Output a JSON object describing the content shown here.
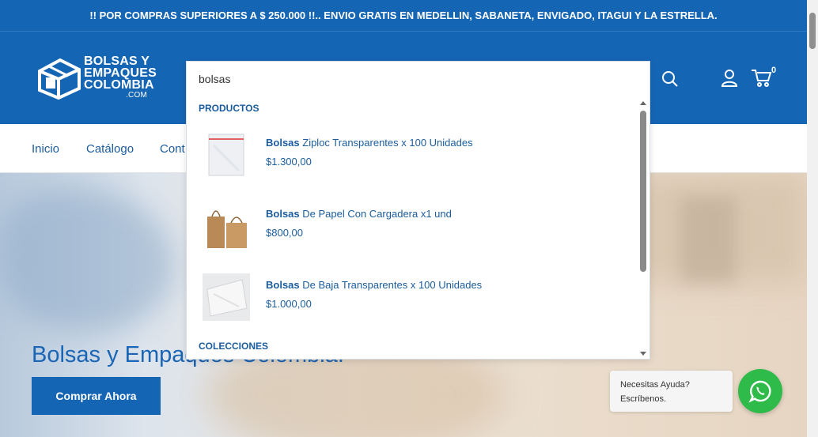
{
  "announcement": "!! POR COMPRAS SUPERIORES A $ 250.000 !!.. ENVIO GRATIS EN MEDELLIN, SABANETA, ENVIGADO, ITAGUI Y LA ESTRELLA.",
  "brand": {
    "line1": "BOLSAS Y",
    "line2": "EMPAQUES",
    "line3": "COLOMBIA",
    "line4": ".COM"
  },
  "header": {
    "cart_count": "0",
    "icons": [
      "search-icon",
      "account-icon",
      "cart-icon"
    ]
  },
  "nav": {
    "items": [
      "Inicio",
      "Catálogo",
      "Cont"
    ]
  },
  "search": {
    "query": "bolsas",
    "products_heading": "PRODUCTOS",
    "collections_heading": "COLECCIONES",
    "products": [
      {
        "highlight": "Bolsas",
        "rest": " Ziploc Transparentes x 100 Unidades",
        "price": "$1.300,00"
      },
      {
        "highlight": "Bolsas",
        "rest": " De Papel Con Cargadera x1 und",
        "price": "$800,00"
      },
      {
        "highlight": "Bolsas",
        "rest": " De Baja Transparentes x 100 Unidades",
        "price": "$1.000,00"
      }
    ]
  },
  "hero": {
    "title": "Bolsas y Empaques Colombia.",
    "button": "Comprar Ahora"
  },
  "help": {
    "line1": "Necesitas Ayuda?",
    "line2": "Escríbenos."
  },
  "colors": {
    "brand_blue": "#1565b5",
    "link_blue": "#1a5c9e",
    "whatsapp_green": "#2fbb4a"
  }
}
